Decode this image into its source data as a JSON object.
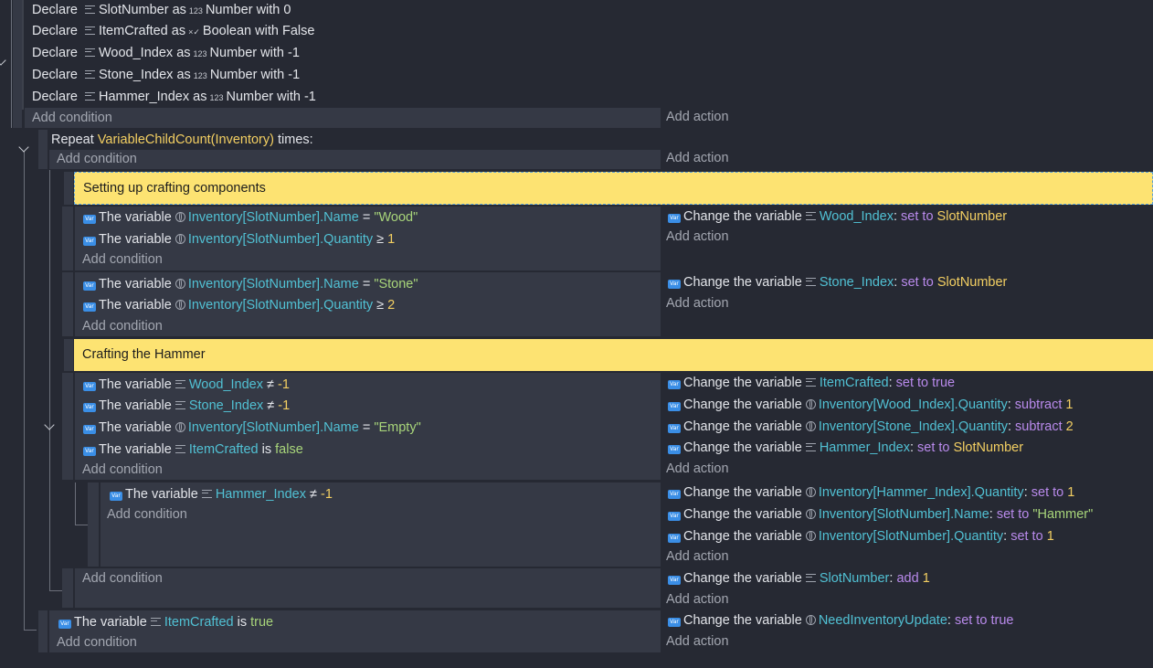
{
  "declares": [
    {
      "kw": "Declare",
      "name": "SlotNumber",
      "as": "as",
      "type_glyph": "123",
      "type": "Number",
      "with": "with",
      "value": "0"
    },
    {
      "kw": "Declare",
      "name": "ItemCrafted",
      "as": "as",
      "type_glyph": "×✓",
      "type": "Boolean",
      "with": "with",
      "value": "False"
    },
    {
      "kw": "Declare",
      "name": "Wood_Index",
      "as": "as",
      "type_glyph": "123",
      "type": "Number",
      "with": "with",
      "value": "-1"
    },
    {
      "kw": "Declare",
      "name": "Stone_Index",
      "as": "as",
      "type_glyph": "123",
      "type": "Number",
      "with": "with",
      "value": "-1"
    },
    {
      "kw": "Declare",
      "name": "Hammer_Index",
      "as": "as",
      "type_glyph": "123",
      "type": "Number",
      "with": "with",
      "value": "-1"
    }
  ],
  "labels": {
    "add_condition": "Add condition",
    "add_action": "Add action",
    "the_variable": "The variable",
    "change_the_variable": "Change the variable"
  },
  "repeat": {
    "kw": "Repeat",
    "expr": "VariableChildCount(Inventory)",
    "tail": "times:"
  },
  "comments": {
    "setup": "Setting up crafting components",
    "craft": "Crafting the Hammer"
  },
  "ev_wood": {
    "c1": {
      "var": "Inventory[SlotNumber].Name",
      "op": "=",
      "val": "\"Wood\""
    },
    "c2": {
      "var": "Inventory[SlotNumber].Quantity",
      "op": "≥",
      "val": "1"
    },
    "a1": {
      "var": "Wood_Index",
      "sep": ":",
      "op": "set to",
      "val": "SlotNumber"
    }
  },
  "ev_stone": {
    "c1": {
      "var": "Inventory[SlotNumber].Name",
      "op": "=",
      "val": "\"Stone\""
    },
    "c2": {
      "var": "Inventory[SlotNumber].Quantity",
      "op": "≥",
      "val": "2"
    },
    "a1": {
      "var": "Stone_Index",
      "sep": ":",
      "op": "set to",
      "val": "SlotNumber"
    }
  },
  "ev_craft": {
    "c1": {
      "var": "Wood_Index",
      "op": "≠",
      "val": "-1"
    },
    "c2": {
      "var": "Stone_Index",
      "op": "≠",
      "val": "-1"
    },
    "c3": {
      "var": "Inventory[SlotNumber].Name",
      "op": "=",
      "val": "\"Empty\""
    },
    "c4": {
      "var": "ItemCrafted",
      "op": "is",
      "val": "false"
    },
    "a1": {
      "var": "ItemCrafted",
      "sep": ":",
      "op": "set to true",
      "val": ""
    },
    "a2": {
      "var": "Inventory[Wood_Index].Quantity",
      "sep": ":",
      "op": "subtract",
      "val": "1"
    },
    "a3": {
      "var": "Inventory[Stone_Index].Quantity",
      "sep": ":",
      "op": "subtract",
      "val": "2"
    },
    "a4": {
      "var": "Hammer_Index",
      "sep": ":",
      "op": "set to",
      "val": "SlotNumber"
    }
  },
  "ev_hammer": {
    "c1": {
      "var": "Hammer_Index",
      "op": "≠",
      "val": "-1"
    },
    "a1": {
      "var": "Inventory[Hammer_Index].Quantity",
      "sep": ":",
      "op": "set to",
      "val": "1"
    },
    "a2": {
      "var": "Inventory[SlotNumber].Name",
      "sep": ":",
      "op": "set to",
      "val": "\"Hammer\""
    },
    "a3": {
      "var": "Inventory[SlotNumber].Quantity",
      "sep": ":",
      "op": "set to",
      "val": "1"
    }
  },
  "ev_slot": {
    "a1": {
      "var": "SlotNumber",
      "sep": ":",
      "op": "add",
      "val": "1"
    }
  },
  "ev_final": {
    "c1": {
      "var": "ItemCrafted",
      "op": "is",
      "val": "true"
    },
    "a1": {
      "var": "NeedInventoryUpdate",
      "sep": ":",
      "op": "set to true",
      "val": ""
    }
  }
}
